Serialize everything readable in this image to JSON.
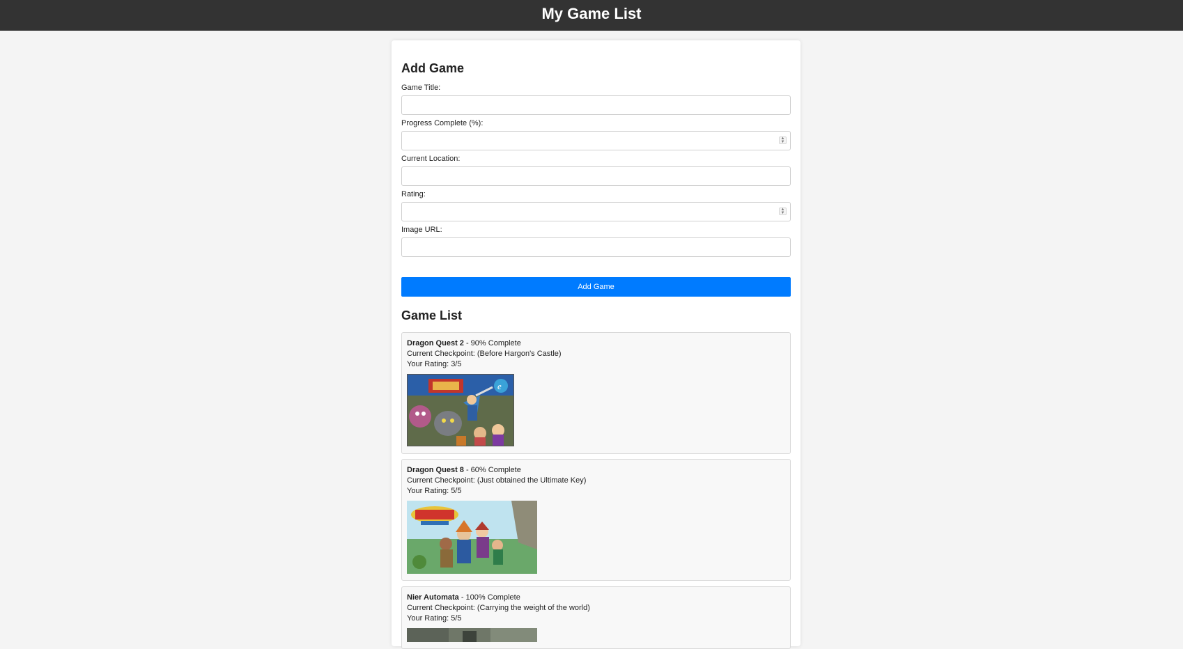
{
  "header": {
    "title": "My Game List"
  },
  "form": {
    "heading": "Add Game",
    "fields": [
      {
        "label": "Game Title:",
        "value": ""
      },
      {
        "label": "Progress Complete (%):",
        "value": ""
      },
      {
        "label": "Current Location:",
        "value": ""
      },
      {
        "label": "Rating:",
        "value": ""
      },
      {
        "label": "Image URL:",
        "value": ""
      }
    ],
    "submit_label": "Add Game"
  },
  "list": {
    "heading": "Game List",
    "games": [
      {
        "title": "Dragon Quest 2",
        "progress_text": " - 90% Complete",
        "checkpoint_text": "Current Checkpoint: (Before Hargon's Castle)",
        "rating_text": "Your Rating: 3/5",
        "cover_icon": "dragon-quest-2-cover"
      },
      {
        "title": "Dragon Quest 8",
        "progress_text": " - 60% Complete",
        "checkpoint_text": "Current Checkpoint: (Just obtained the Ultimate Key)",
        "rating_text": "Your Rating: 5/5",
        "cover_icon": "dragon-quest-8-cover"
      },
      {
        "title": "Nier Automata",
        "progress_text": " - 100% Complete",
        "checkpoint_text": "Current Checkpoint: (Carrying the weight of the world)",
        "rating_text": "Your Rating: 5/5",
        "cover_icon": "nier-automata-cover"
      }
    ]
  },
  "colors": {
    "header_bg": "#333333",
    "button_bg": "#007bff",
    "page_bg": "#f4f4f4"
  }
}
